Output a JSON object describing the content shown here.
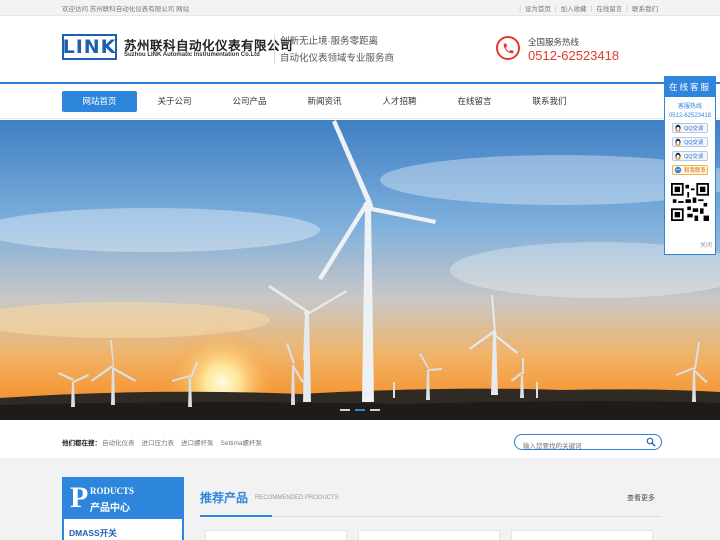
{
  "topbar": {
    "welcome": "欢迎访问 苏州联科自动化仪表有限公司 网站",
    "links": [
      "设为首页",
      "加入收藏",
      "在线留言",
      "联系我们"
    ]
  },
  "header": {
    "logo_text": "LINK",
    "company_cn": "苏州联科自动化仪表有限公司",
    "company_en": "Suzhou LINK Automatic Instrumentation Co.Ltd",
    "slogan_line1": "创新无止境·服务零距离",
    "slogan_line2": "自动化仪表领域专业服务商",
    "hotline_label": "全国服务热线",
    "hotline_number": "0512-62523418"
  },
  "nav": {
    "items": [
      "网站首页",
      "关于公司",
      "公司产品",
      "新闻资讯",
      "人才招聘",
      "在线留言",
      "联系我们"
    ],
    "active_index": 0
  },
  "banner": {
    "slides": 3,
    "active_slide": 1
  },
  "search": {
    "hot_label": "他们都在搜：",
    "hot_links": [
      "自动化仪表",
      "进口压力表",
      "进口螺杆泵",
      "Settima螺杆泵"
    ],
    "placeholder": "输入您要找的关键词"
  },
  "products": {
    "letter": "P",
    "title_en": "RODUCTS",
    "title_cn": "产品中心",
    "first_item": "DMASS开关"
  },
  "recommended": {
    "title": "推荐产品",
    "title_en": "RECOMMENDED PRODUCTS",
    "more": "查看更多"
  },
  "float_panel": {
    "title": "在线客服",
    "hotline_label": "客服热线",
    "hotline_number": "0512-62523418",
    "qq_buttons": [
      "QQ交谈",
      "QQ交谈",
      "QQ交谈"
    ],
    "wangwang": "和我联系",
    "close": "关闭"
  },
  "colors": {
    "brand_blue": "#2d86dc",
    "accent_red": "#e23b2e"
  }
}
